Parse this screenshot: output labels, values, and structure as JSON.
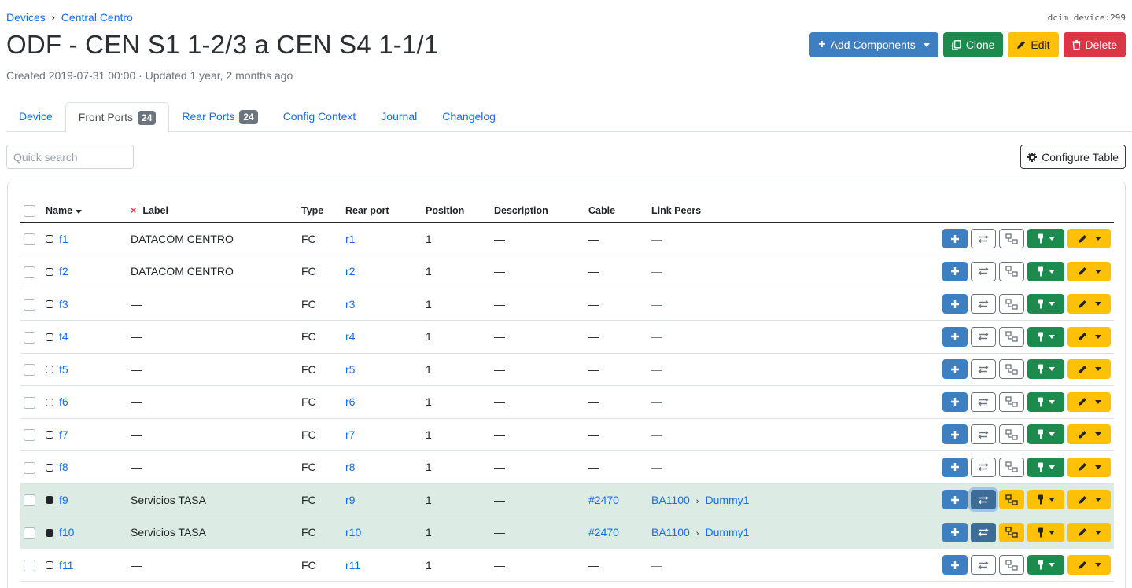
{
  "breadcrumb": [
    "Devices",
    "Central Centro"
  ],
  "object_ref": "dcim.device:299",
  "title": "ODF - CEN S1 1-2/3 a CEN S4 1-1/1",
  "meta": "Created 2019-07-31 00:00 · Updated 1 year, 2 months ago",
  "actions": {
    "add_components": "Add Components",
    "clone": "Clone",
    "edit": "Edit",
    "delete": "Delete"
  },
  "tabs": [
    {
      "label": "Device",
      "count": ""
    },
    {
      "label": "Front Ports",
      "count": "24"
    },
    {
      "label": "Rear Ports",
      "count": "24"
    },
    {
      "label": "Config Context",
      "count": ""
    },
    {
      "label": "Journal",
      "count": ""
    },
    {
      "label": "Changelog",
      "count": ""
    }
  ],
  "search": {
    "placeholder": "Quick search"
  },
  "configure_table": "Configure Table",
  "table": {
    "headers": {
      "name": "Name",
      "label": "Label",
      "type": "Type",
      "rear_port": "Rear port",
      "position": "Position",
      "description": "Description",
      "cable": "Cable",
      "link_peers": "Link Peers"
    },
    "rows": [
      {
        "name": "f1",
        "label": "DATACOM CENTRO",
        "type": "FC",
        "rear_port": "r1",
        "position": "1",
        "description": "—",
        "cable": "—",
        "peer": "—",
        "peer_device": "",
        "peer_port": ""
      },
      {
        "name": "f2",
        "label": "DATACOM CENTRO",
        "type": "FC",
        "rear_port": "r2",
        "position": "1",
        "description": "—",
        "cable": "—",
        "peer": "—",
        "peer_device": "",
        "peer_port": ""
      },
      {
        "name": "f3",
        "label": "—",
        "type": "FC",
        "rear_port": "r3",
        "position": "1",
        "description": "—",
        "cable": "—",
        "peer": "—",
        "peer_device": "",
        "peer_port": ""
      },
      {
        "name": "f4",
        "label": "—",
        "type": "FC",
        "rear_port": "r4",
        "position": "1",
        "description": "—",
        "cable": "—",
        "peer": "—",
        "peer_device": "",
        "peer_port": ""
      },
      {
        "name": "f5",
        "label": "—",
        "type": "FC",
        "rear_port": "r5",
        "position": "1",
        "description": "—",
        "cable": "—",
        "peer": "—",
        "peer_device": "",
        "peer_port": ""
      },
      {
        "name": "f6",
        "label": "—",
        "type": "FC",
        "rear_port": "r6",
        "position": "1",
        "description": "—",
        "cable": "—",
        "peer": "—",
        "peer_device": "",
        "peer_port": ""
      },
      {
        "name": "f7",
        "label": "—",
        "type": "FC",
        "rear_port": "r7",
        "position": "1",
        "description": "—",
        "cable": "—",
        "peer": "—",
        "peer_device": "",
        "peer_port": ""
      },
      {
        "name": "f8",
        "label": "—",
        "type": "FC",
        "rear_port": "r8",
        "position": "1",
        "description": "—",
        "cable": "—",
        "peer": "—",
        "peer_device": "",
        "peer_port": ""
      },
      {
        "name": "f9",
        "label": "Servicios TASA",
        "type": "FC",
        "rear_port": "r9",
        "position": "1",
        "description": "—",
        "cable": "#2470",
        "peer": "",
        "peer_device": "BA1100",
        "peer_port": "Dummy1"
      },
      {
        "name": "f10",
        "label": "Servicios TASA",
        "type": "FC",
        "rear_port": "r10",
        "position": "1",
        "description": "—",
        "cable": "#2470",
        "peer": "",
        "peer_device": "BA1100",
        "peer_port": "Dummy1"
      },
      {
        "name": "f11",
        "label": "—",
        "type": "FC",
        "rear_port": "r11",
        "position": "1",
        "description": "—",
        "cable": "—",
        "peer": "—",
        "peer_device": "",
        "peer_port": ""
      }
    ]
  },
  "colors": {
    "primary": "#3d7fc1",
    "success": "#1d8a4e",
    "warning": "#ffc107",
    "danger": "#dc3545",
    "connected_row": "#dcebe3"
  }
}
